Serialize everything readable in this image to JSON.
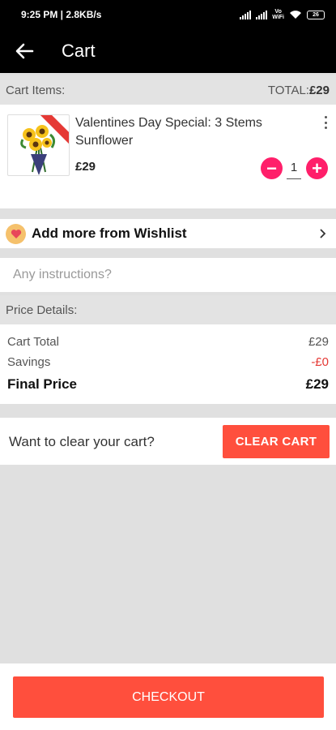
{
  "status_bar": {
    "time_speed": "9:25 PM | 2.8KB/s",
    "volte": "Vo\nWiFi",
    "battery": "26"
  },
  "app_bar": {
    "title": "Cart",
    "back_icon": "arrow-left-icon"
  },
  "cart_items_header": {
    "label": "Cart Items:",
    "total_label": "TOTAL:",
    "total_value": "£29"
  },
  "cart_items": [
    {
      "name": "Valentines Day Special: 3 Stems Sunflower",
      "price": "£29",
      "quantity": "1",
      "image_icon": "sunflower-bouquet-icon"
    }
  ],
  "quantity_controls": {
    "minus": "−",
    "plus": "+"
  },
  "wishlist": {
    "label": "Add more from Wishlist",
    "icon": "heart-icon"
  },
  "instructions": {
    "placeholder": "Any instructions?",
    "value": ""
  },
  "price_details": {
    "header": "Price Details:",
    "rows": [
      {
        "label": "Cart Total",
        "value": "£29"
      },
      {
        "label": "Savings",
        "value": "-£0"
      },
      {
        "label": "Final Price",
        "value": "£29"
      }
    ]
  },
  "clear_cart": {
    "prompt": "Want to clear your cart?",
    "button": "CLEAR CART"
  },
  "checkout": {
    "button": "CHECKOUT"
  },
  "colors": {
    "accent": "#ff4f3d",
    "qty_button": "#ff1f6a",
    "savings": "#e53935",
    "heart_badge": "#f5c16c"
  }
}
